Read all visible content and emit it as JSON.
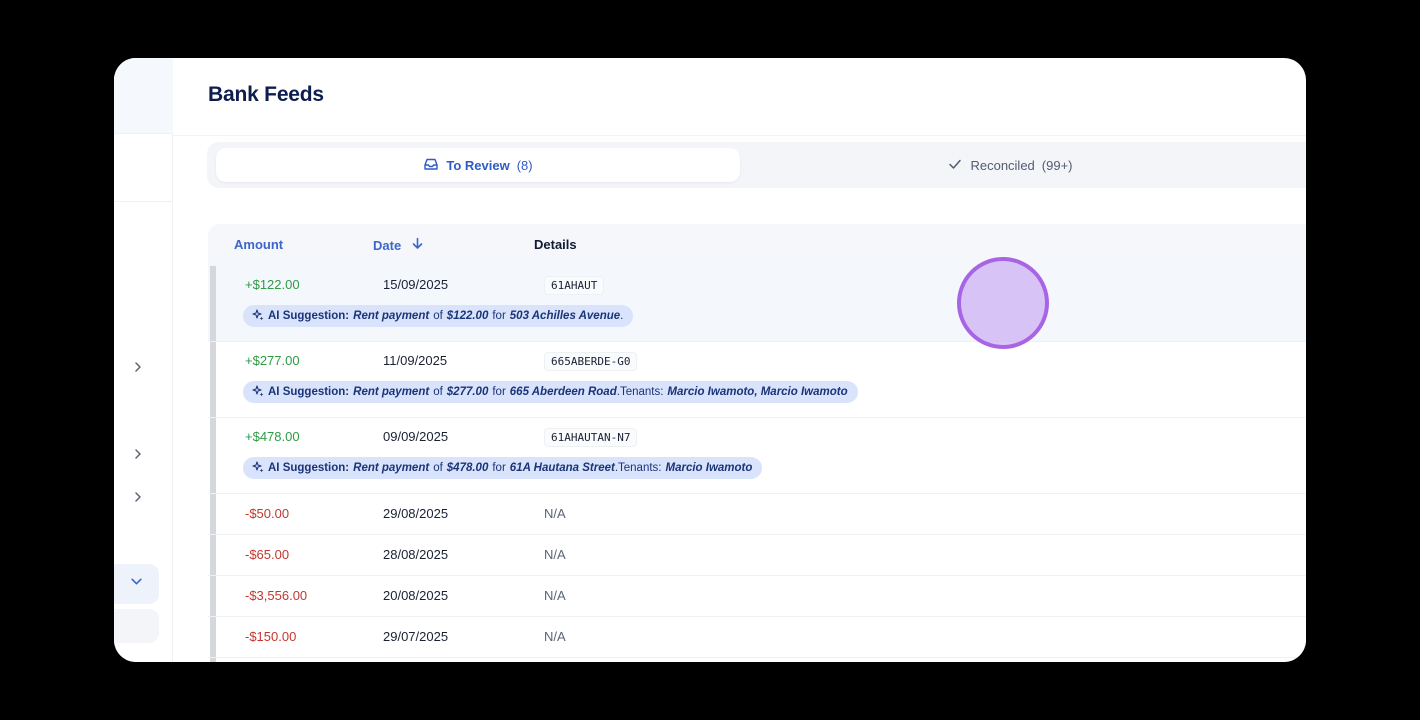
{
  "page": {
    "title": "Bank Feeds"
  },
  "tabs": [
    {
      "label": "To Review",
      "count": "(8)",
      "active": true,
      "icon": "inbox-icon"
    },
    {
      "label": "Reconciled",
      "count": "(99+)",
      "active": false,
      "icon": "check-icon"
    }
  ],
  "table": {
    "headers": {
      "amount": "Amount",
      "date": "Date",
      "details": "Details"
    },
    "rows": [
      {
        "amount": "+$122.00",
        "date": "15/09/2025",
        "details": "61AHAUT",
        "ai": {
          "label": "AI Suggestion:",
          "category": "Rent payment",
          "of": "of",
          "value": "$122.00",
          "for": "for",
          "property": "503 Achilles Avenue",
          "end": ".",
          "tenants_label": "",
          "tenants": ""
        }
      },
      {
        "amount": "+$277.00",
        "date": "11/09/2025",
        "details": "665ABERDE-G0",
        "ai": {
          "label": "AI Suggestion:",
          "category": "Rent payment",
          "of": "of",
          "value": "$277.00",
          "for": "for",
          "property": "665 Aberdeen Road",
          "end": ".",
          "tenants_label": " Tenants:",
          "tenants": "Marcio Iwamoto, Marcio Iwamoto"
        }
      },
      {
        "amount": "+$478.00",
        "date": "09/09/2025",
        "details": "61AHAUTAN-N7",
        "ai": {
          "label": "AI Suggestion:",
          "category": "Rent payment",
          "of": "of",
          "value": "$478.00",
          "for": "for",
          "property": "61A Hautana Street",
          "end": ".",
          "tenants_label": " Tenants:",
          "tenants": "Marcio Iwamoto"
        }
      },
      {
        "amount": "-$50.00",
        "date": "29/08/2025",
        "details": "N/A"
      },
      {
        "amount": "-$65.00",
        "date": "28/08/2025",
        "details": "N/A"
      },
      {
        "amount": "-$3,556.00",
        "date": "20/08/2025",
        "details": "N/A"
      },
      {
        "amount": "-$150.00",
        "date": "29/07/2025",
        "details": "N/A"
      }
    ]
  },
  "colors": {
    "accent": "#2e5bc7",
    "positive": "#2e9b45",
    "negative": "#c4372f",
    "ai_badge": "#d9e3fb",
    "cursor": "#a864e4"
  }
}
